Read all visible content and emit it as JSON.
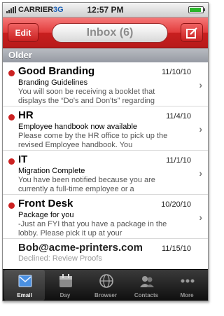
{
  "status_bar": {
    "carrier": "CARRIER",
    "network": "3G",
    "time": "12:57 PM",
    "battery_level": 0.9
  },
  "nav": {
    "edit_label": "Edit",
    "title": "Inbox (6)"
  },
  "section": {
    "title": "Older"
  },
  "messages": [
    {
      "sender": "Good Branding",
      "date": "11/10/10",
      "subject": "Branding Guidelines",
      "preview": "You will soon be receiving a booklet that displays the “Do's and Don'ts” regarding",
      "unread": true
    },
    {
      "sender": "HR",
      "date": "11/4/10",
      "subject": "Employee handbook now available",
      "preview": "Please come by the HR office to pick up the revised Employee handbook. You",
      "unread": true
    },
    {
      "sender": "IT",
      "date": "11/1/10",
      "subject": "Migration Complete",
      "preview": "You have been notified because you are currently a full-time employee or a",
      "unread": true
    },
    {
      "sender": "Front Desk",
      "date": "10/20/10",
      "subject": "Package for you",
      "preview": "-Just an FYI that you have a package in the lobby. Please pick it up at your",
      "unread": true
    },
    {
      "sender": "Bob@acme-printers.com",
      "date": "11/15/10",
      "subject": "Declined: Review Proofs",
      "preview": "",
      "unread": false
    }
  ],
  "tabs": [
    {
      "label": "Email",
      "icon": "email-icon",
      "active": true
    },
    {
      "label": "Day",
      "icon": "calendar-icon",
      "active": false
    },
    {
      "label": "Browser",
      "icon": "globe-icon",
      "active": false
    },
    {
      "label": "Contacts",
      "icon": "contacts-icon",
      "active": false
    },
    {
      "label": "More",
      "icon": "more-icon",
      "active": false
    }
  ],
  "colors": {
    "accent": "#d62a2a",
    "unread_dot": "#cc2222",
    "section_header": "#a4a8b0"
  }
}
